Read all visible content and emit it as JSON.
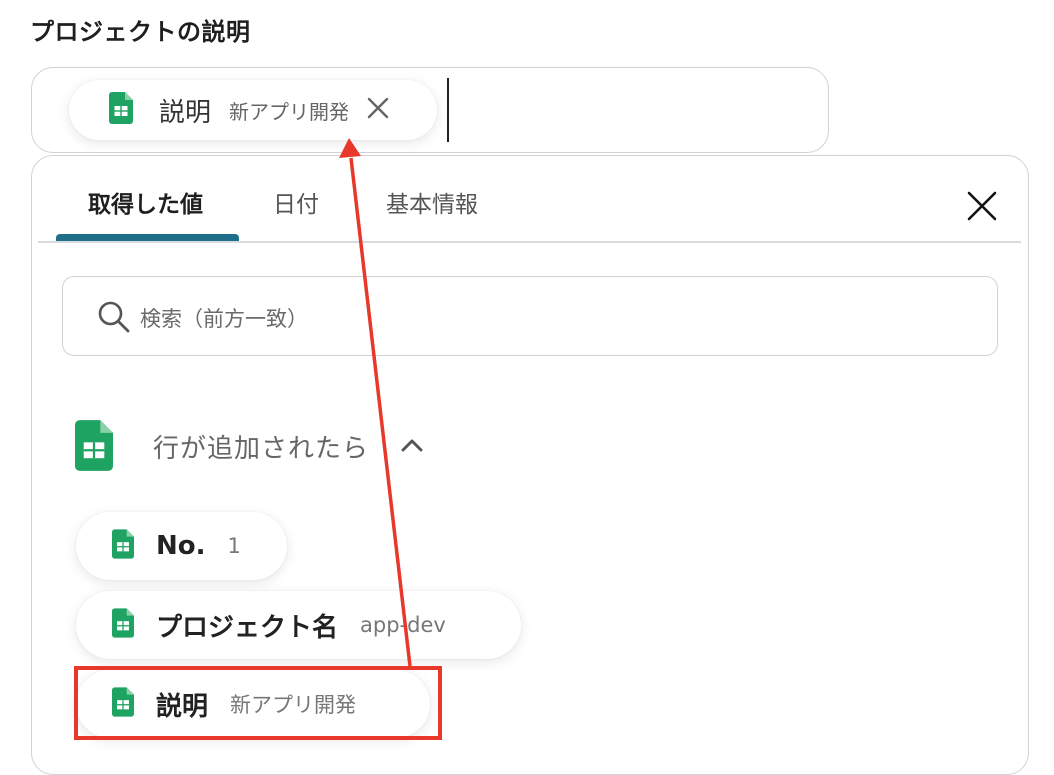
{
  "field": {
    "title": "プロジェクトの説明"
  },
  "selected_chip": {
    "icon": "spreadsheet-icon",
    "label": "説明",
    "value": "新アプリ開発"
  },
  "tabs": [
    {
      "label": "取得した値",
      "active": true
    },
    {
      "label": "日付",
      "active": false
    },
    {
      "label": "基本情報",
      "active": false
    }
  ],
  "search": {
    "placeholder": "検索（前方一致）",
    "icon": "search-icon"
  },
  "group": {
    "icon": "spreadsheet-icon",
    "title": "行が追加されたら",
    "expanded": true
  },
  "items": [
    {
      "label": "No.",
      "value": "1"
    },
    {
      "label": "プロジェクト名",
      "value": "app-dev"
    },
    {
      "label": "説明",
      "value": "新アプリ開発"
    }
  ],
  "colors": {
    "accent": "#1f6f8b",
    "sheets_green": "#1ea362",
    "annotation_red": "#e8372b"
  }
}
